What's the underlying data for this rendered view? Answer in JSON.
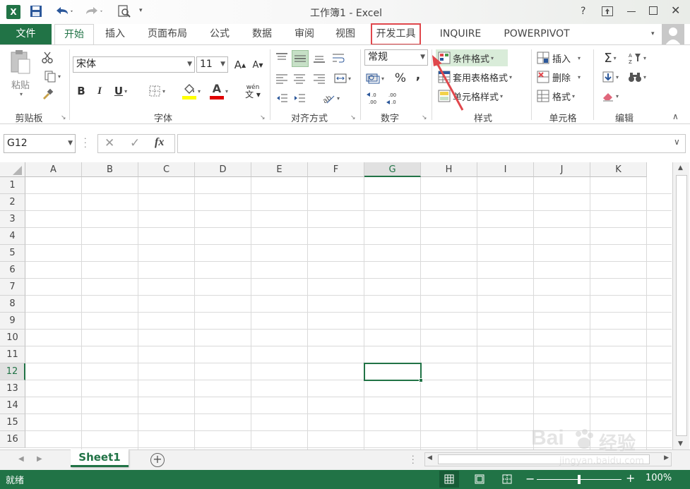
{
  "titlebar": {
    "title": "工作簿1 - Excel",
    "help": "?",
    "quick_access": [
      "excel-logo",
      "save",
      "undo",
      "redo",
      "print-preview",
      "customize"
    ]
  },
  "tabs": {
    "file": "文件",
    "items": [
      "开始",
      "插入",
      "页面布局",
      "公式",
      "数据",
      "审阅",
      "视图",
      "开发工具",
      "INQUIRE",
      "POWERPIVOT"
    ],
    "active_index": 0,
    "highlighted_index": 7
  },
  "ribbon": {
    "clipboard": {
      "paste": "粘贴",
      "group": "剪贴板"
    },
    "font": {
      "name": "宋体",
      "size": "11",
      "group": "字体",
      "grow": "A",
      "shrink": "A",
      "bold": "B",
      "italic": "I",
      "underline": "U",
      "font_color_letter": "A",
      "phonetic": "wén"
    },
    "alignment": {
      "group": "对齐方式"
    },
    "number": {
      "format": "常规",
      "percent": "%",
      "comma": ",",
      "group": "数字"
    },
    "styles": {
      "conditional": "条件格式",
      "table": "套用表格格式",
      "cell": "单元格样式",
      "group": "样式"
    },
    "cells": {
      "insert": "插入",
      "delete": "删除",
      "format": "格式",
      "group": "单元格"
    },
    "editing": {
      "group": "编辑"
    }
  },
  "formula_bar": {
    "name_box": "G12",
    "fx": "fx",
    "value": ""
  },
  "grid": {
    "columns": [
      "A",
      "B",
      "C",
      "D",
      "E",
      "F",
      "G",
      "H",
      "I",
      "J",
      "K"
    ],
    "rows": [
      "1",
      "2",
      "3",
      "4",
      "5",
      "6",
      "7",
      "8",
      "9",
      "10",
      "11",
      "12",
      "13",
      "14",
      "15",
      "16"
    ],
    "active_col": "G",
    "active_row": "12"
  },
  "sheets": {
    "tabs": [
      "Sheet1"
    ]
  },
  "status": {
    "ready": "就绪",
    "zoom": "100%",
    "zoom_level": 100
  },
  "watermark": {
    "brand": "Bai",
    "brand2": "经验",
    "url": "jingyan.baidu.com"
  },
  "colors": {
    "excel_green": "#217346",
    "highlight_red": "#e0474c",
    "sheet_tab_text": "#217346"
  }
}
